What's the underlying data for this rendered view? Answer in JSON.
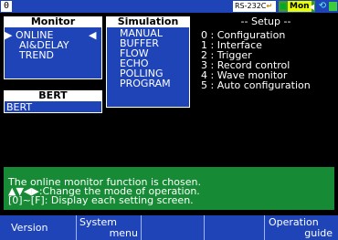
{
  "status_bar": {
    "page_number": "0",
    "interface_label": "RS-232C",
    "mode_label": "Mon",
    "mode_icon": "monitor-status-icon",
    "usb_icon": "usb-icon",
    "battery_icon": "battery-icon",
    "colors": {
      "bar": "#1e44b8",
      "mode_badge": "#e9ff00",
      "battery": "#3ccc3c"
    }
  },
  "monitor": {
    "title": "Monitor",
    "items": [
      {
        "label": "ONLINE",
        "selected": true
      },
      {
        "label": "AI&DELAY",
        "selected": false
      },
      {
        "label": "TREND",
        "selected": false
      }
    ]
  },
  "bert": {
    "title": "BERT",
    "items": [
      {
        "label": "BERT"
      }
    ]
  },
  "simulation": {
    "title": "Simulation",
    "items": [
      {
        "label": "MANUAL"
      },
      {
        "label": "BUFFER"
      },
      {
        "label": "FLOW"
      },
      {
        "label": "ECHO"
      },
      {
        "label": "POLLING"
      },
      {
        "label": "PROGRAM"
      }
    ]
  },
  "setup": {
    "title": "-- Setup --",
    "lines": [
      "0 : Configuration",
      "1 : Interface",
      "2 : Trigger",
      "3 : Record control",
      "4 : Wave monitor",
      "5 : Auto configuration"
    ]
  },
  "info": {
    "lines": [
      "The online monitor function is chosen.",
      "▲▼◀▶:Change the mode of operation.",
      "[0]~[F]: Display each setting screen."
    ],
    "color": "#168a34"
  },
  "function_keys": [
    {
      "line1": "Version",
      "line2": ""
    },
    {
      "line1": "System",
      "line2": "menu"
    },
    {
      "line1": "",
      "line2": ""
    },
    {
      "line1": "",
      "line2": ""
    },
    {
      "line1": "",
      "line2": ""
    },
    {
      "line1": "Operation",
      "line2": "guide"
    }
  ]
}
